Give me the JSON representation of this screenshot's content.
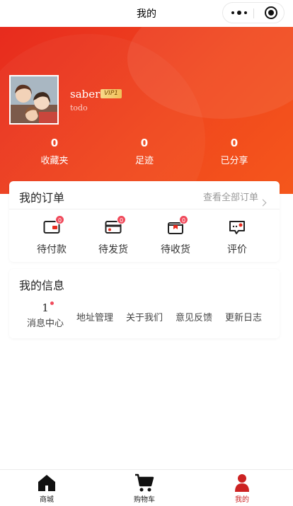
{
  "navbar": {
    "title": "我的"
  },
  "user": {
    "name": "saber",
    "vip": "VIP1",
    "subtitle": "todo"
  },
  "stats": [
    {
      "value": "0",
      "label": "收藏夹"
    },
    {
      "value": "0",
      "label": "足迹"
    },
    {
      "value": "0",
      "label": "已分享"
    }
  ],
  "orders": {
    "title": "我的订单",
    "view_all": "查看全部订单",
    "items": [
      {
        "label": "待付款",
        "badge": "0",
        "icon": "wallet-icon"
      },
      {
        "label": "待发货",
        "badge": "0",
        "icon": "card-icon"
      },
      {
        "label": "待收货",
        "badge": "0",
        "icon": "package-icon"
      },
      {
        "label": "评价",
        "icon": "comment-icon"
      }
    ]
  },
  "info": {
    "title": "我的信息",
    "items": [
      {
        "count": "1",
        "label": "消息中心"
      },
      {
        "label": "地址管理"
      },
      {
        "label": "关于我们"
      },
      {
        "label": "意见反馈"
      },
      {
        "label": "更新日志"
      }
    ]
  },
  "tabbar": [
    {
      "label": "商城",
      "icon": "home-icon"
    },
    {
      "label": "购物车",
      "icon": "cart-icon"
    },
    {
      "label": "我的",
      "icon": "user-icon",
      "active": true
    }
  ],
  "colors": {
    "accent": "#e72b1e",
    "badge": "#f04a5b",
    "active_tab": "#c22222"
  }
}
